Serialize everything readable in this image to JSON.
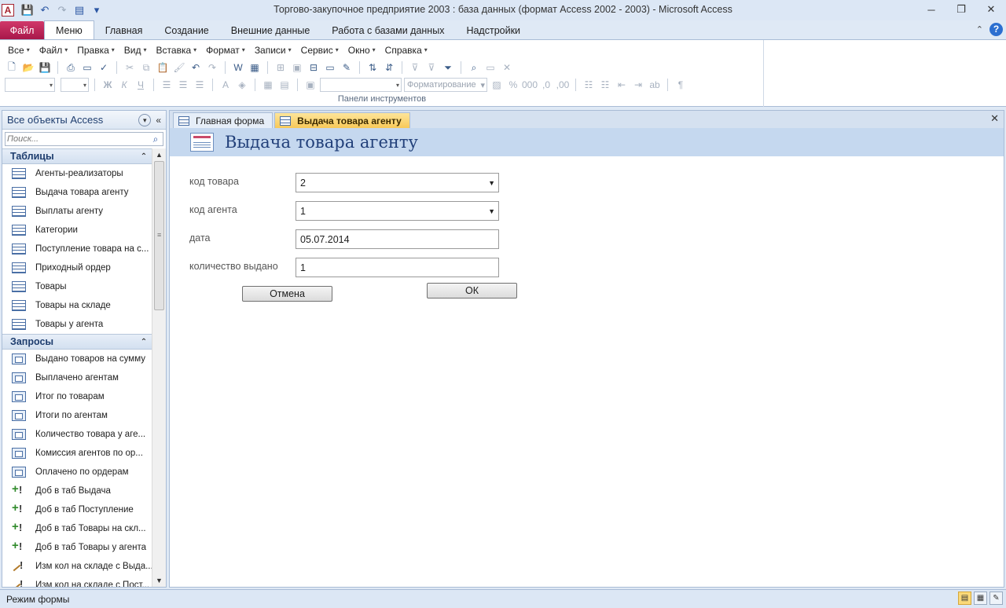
{
  "window": {
    "title": "Торгово-закупочное предприятие 2003 : база данных (формат Access 2002 - 2003)  -  Microsoft Access",
    "app_icon": "A",
    "controls": {
      "minimize": "─",
      "restore": "❐",
      "close": "✕"
    }
  },
  "ribbon": {
    "file_tab": "Файл",
    "tabs": [
      "Меню",
      "Главная",
      "Создание",
      "Внешние данные",
      "Работа с базами данных",
      "Надстройки"
    ],
    "active_tab": "Меню",
    "menus": [
      "Все",
      "Файл",
      "Правка",
      "Вид",
      "Вставка",
      "Формат",
      "Записи",
      "Сервис",
      "Окно",
      "Справка"
    ],
    "formatting_combo": "Форматирование",
    "group_label": "Панели инструментов",
    "help": "?"
  },
  "nav": {
    "title": "Все объекты Access",
    "search_placeholder": "Поиск...",
    "groups": [
      {
        "label": "Таблицы",
        "items": [
          "Агенты-реализаторы",
          "Выдача товара агенту",
          "Выплаты агенту",
          "Категории",
          "Поступление товара на с...",
          "Приходный ордер",
          "Товары",
          "Товары на складе",
          "Товары у агента"
        ]
      },
      {
        "label": "Запросы",
        "items": [
          "Выдано товаров на сумму",
          "Выплачено агентам",
          "Итог по товарам",
          "Итоги по агентам",
          "Количество товара у аге...",
          "Комиссия агентов по ор...",
          "Оплачено по ордерам",
          "Доб в таб Выдача",
          "Доб в таб Поступление",
          "Доб в таб Товары на скл...",
          "Доб в таб Товары у агента",
          "Изм кол на складе с Выда...",
          "Изм кол на складе с Пост..."
        ]
      }
    ]
  },
  "doc_tabs": [
    "Главная форма",
    "Выдача товара агенту"
  ],
  "form": {
    "title": "Выдача товара агенту",
    "fields": [
      {
        "label": "код товара",
        "value": "2"
      },
      {
        "label": "код агента",
        "value": "1"
      },
      {
        "label": "дата",
        "value": "05.07.2014"
      },
      {
        "label": "количество выдано",
        "value": "1"
      }
    ],
    "cancel_label": "Отмена",
    "ok_label": "ОК"
  },
  "status": {
    "text": "Режим формы"
  }
}
